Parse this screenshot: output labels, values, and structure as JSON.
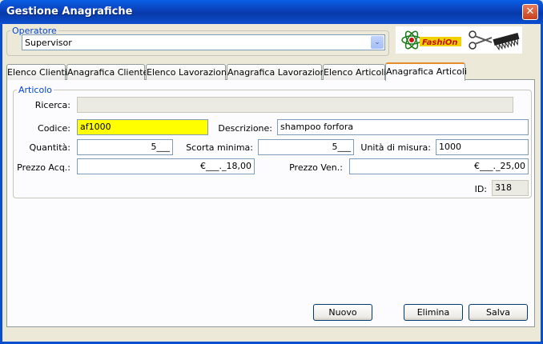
{
  "window": {
    "title": "Gestione Anagrafiche",
    "close_glyph": "✕"
  },
  "operatore": {
    "legend": "Operatore",
    "selected": "Supervisor",
    "arrow_glyph": "⌄"
  },
  "logo": {
    "brand_text": "FashiOn"
  },
  "tabs": [
    {
      "label": "Elenco Clienti"
    },
    {
      "label": "Anagrafica Cliente"
    },
    {
      "label": "Elenco Lavorazioni"
    },
    {
      "label": "Anagrafica Lavorazioni"
    },
    {
      "label": "Elenco Articoli"
    },
    {
      "label": "Anagrafica Articoli"
    }
  ],
  "articolo": {
    "legend": "Articolo",
    "ricerca": {
      "label": "Ricerca:",
      "value": ""
    },
    "codice": {
      "label": "Codice:",
      "value": "af1000"
    },
    "descrizione": {
      "label": "Descrizione:",
      "value": "shampoo forfora"
    },
    "quantita": {
      "label": "Quantità:",
      "value": "5___"
    },
    "scorta_minima": {
      "label": "Scorta minima:",
      "value": "5___"
    },
    "unita_misura": {
      "label": "Unità di misura:",
      "value": "1000"
    },
    "prezzo_acq": {
      "label": "Prezzo Acq.:",
      "value": "€___._18,00"
    },
    "prezzo_ven": {
      "label": "Prezzo Ven.:",
      "value": "€___._25,00"
    },
    "id": {
      "label": "ID:",
      "value": "318"
    }
  },
  "buttons": {
    "nuovo": "Nuovo",
    "elimina": "Elimina",
    "salva": "Salva"
  }
}
